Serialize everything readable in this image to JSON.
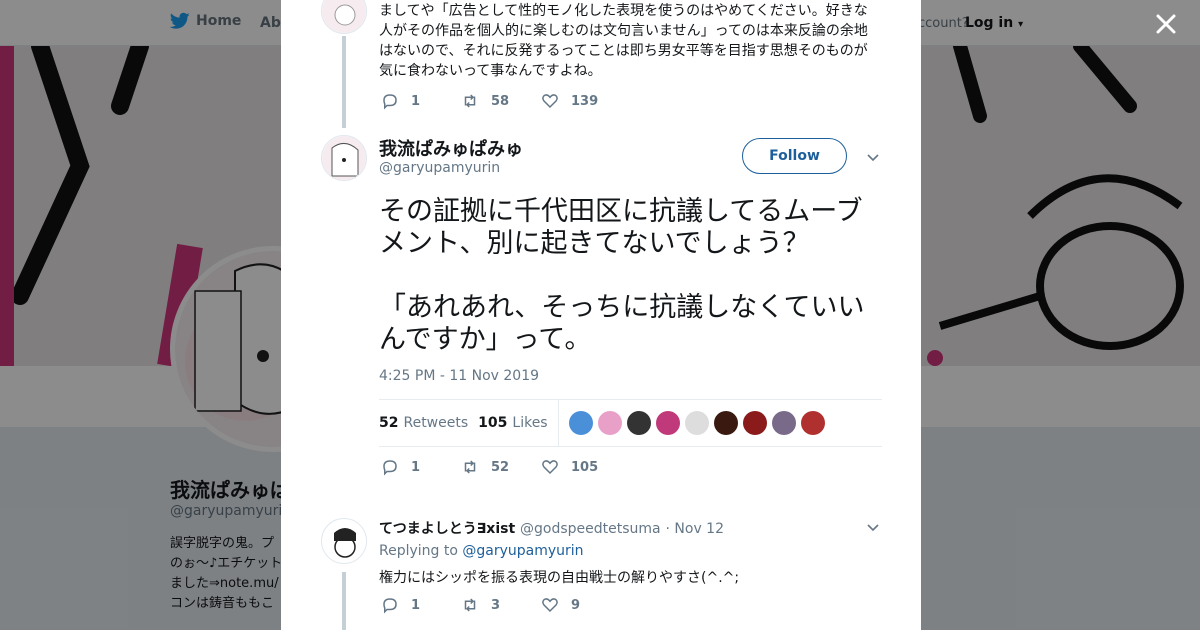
{
  "nav": {
    "home_label": "Home",
    "about_label": "Abo",
    "account_text": "ccount?",
    "login_label": "Log in"
  },
  "profile": {
    "name": "我流ぱみゅぱみゅ",
    "handle": "@garyupamyurin",
    "bio_lines": [
      "誤字脱字の鬼。プ",
      "のぉ～♪エチケット",
      "ました⇒note.mu/",
      "コンは鋳音ももこ"
    ]
  },
  "previous_tweet": {
    "text": "ましてや「広告として性的モノ化した表現を使うのはやめてください。好きな人がその作品を個人的に楽しむのは文句言いません」ってのは本来反論の余地はないので、それに反発するってことは即ち男女平等を目指す思想そのものが気に食わないって事なんですよね。",
    "replies": "1",
    "retweets": "58",
    "likes": "139"
  },
  "main_tweet": {
    "name": "我流ぱみゅぱみゅ",
    "handle": "@garyupamyurin",
    "follow_label": "Follow",
    "text": "その証拠に千代田区に抗議してるムーブメント、別に起きてないでしょう？\n\n「あれあれ、そっちに抗議しなくていいんですか」って。",
    "timestamp": "4:25 PM - 11 Nov 2019",
    "retweet_count": "52",
    "retweet_label": "Retweets",
    "like_count": "105",
    "like_label": "Likes",
    "replies": "1",
    "retweets": "52",
    "likes": "105",
    "liker_colors": [
      "#4a90d9",
      "#e8a0c8",
      "#333333",
      "#c0397a",
      "#dddddd",
      "#3a1a10",
      "#8b1a1a",
      "#7a6a8a",
      "#b03030"
    ]
  },
  "reply_tweet": {
    "name": "てつまよしとう∃xist",
    "handle": "@godspeedtetsuma",
    "date": "· Nov 12",
    "replying_prefix": "Replying to",
    "replying_handle": "@garyupamyurin",
    "text": "権力にはシッポを振る表現の自由戦士の解りやすさ(^.^;",
    "replies": "1",
    "retweets": "3",
    "likes": "9"
  },
  "colors": {
    "accent": "#1d5f9a",
    "muted": "#657786",
    "banner_pink": "#d0357a"
  }
}
